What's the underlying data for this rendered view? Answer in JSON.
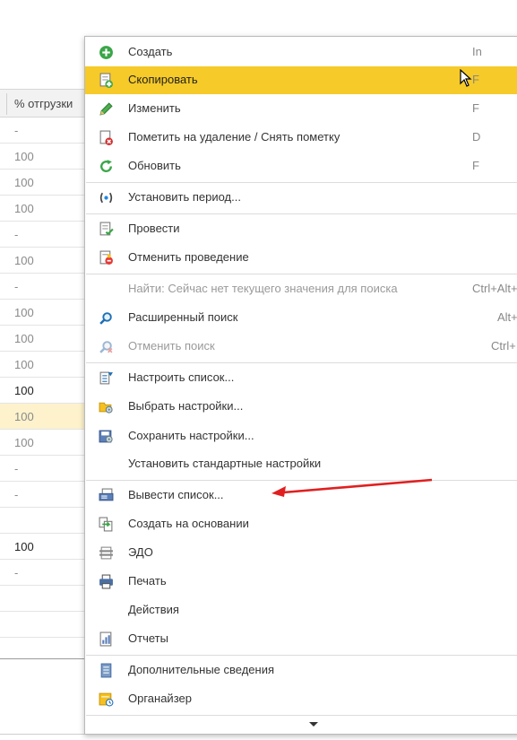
{
  "table": {
    "column_header": "% отгрузки",
    "rows": [
      "-",
      "100",
      "100",
      "100",
      "-",
      "100",
      "-",
      "100",
      "100",
      "100",
      "100",
      "100",
      "100",
      "-",
      "-",
      "",
      "100",
      "-",
      "",
      ""
    ]
  },
  "menu": {
    "items": [
      {
        "label": "Создать",
        "shortcut": "In",
        "icon": "create-plus-icon"
      },
      {
        "label": "Скопировать",
        "shortcut": "F",
        "icon": "copy-icon"
      },
      {
        "label": "Изменить",
        "shortcut": "F",
        "icon": "pencil-icon"
      },
      {
        "label": "Пометить на удаление / Снять пометку",
        "shortcut": "D",
        "icon": "delete-mark-icon"
      },
      {
        "label": "Обновить",
        "shortcut": "F",
        "icon": "refresh-icon"
      },
      {
        "label": "Установить период...",
        "shortcut": "",
        "icon": "period-icon"
      },
      {
        "label": "Провести",
        "shortcut": "",
        "icon": "post-document-icon"
      },
      {
        "label": "Отменить проведение",
        "shortcut": "",
        "icon": "unpost-document-icon"
      },
      {
        "label": "Найти: Сейчас нет текущего значения для поиска",
        "shortcut": "Ctrl+Alt+",
        "icon": ""
      },
      {
        "label": "Расширенный поиск",
        "shortcut": "Alt+",
        "icon": "search-icon"
      },
      {
        "label": "Отменить поиск",
        "shortcut": "Ctrl+",
        "icon": "cancel-search-icon"
      },
      {
        "label": "Настроить список...",
        "shortcut": "",
        "icon": "configure-list-icon"
      },
      {
        "label": "Выбрать настройки...",
        "shortcut": "",
        "icon": "choose-settings-icon"
      },
      {
        "label": "Сохранить настройки...",
        "shortcut": "",
        "icon": "save-settings-icon"
      },
      {
        "label": "Установить стандартные настройки",
        "shortcut": "",
        "icon": ""
      },
      {
        "label": "Вывести список...",
        "shortcut": "",
        "icon": "output-list-icon"
      },
      {
        "label": "Создать на основании",
        "shortcut": "",
        "icon": "create-based-on-icon"
      },
      {
        "label": "ЭДО",
        "shortcut": "",
        "icon": "edo-icon"
      },
      {
        "label": "Печать",
        "shortcut": "",
        "icon": "printer-icon"
      },
      {
        "label": "Действия",
        "shortcut": "",
        "icon": ""
      },
      {
        "label": "Отчеты",
        "shortcut": "",
        "icon": "reports-icon"
      },
      {
        "label": "Дополнительные сведения",
        "shortcut": "",
        "icon": "additional-info-icon"
      },
      {
        "label": "Органайзер",
        "shortcut": "",
        "icon": "organizer-icon"
      }
    ]
  },
  "colors": {
    "selected_item": "#f6ca28",
    "highlight_row": "#fdf2cc",
    "annotation_arrow": "#e02020"
  }
}
